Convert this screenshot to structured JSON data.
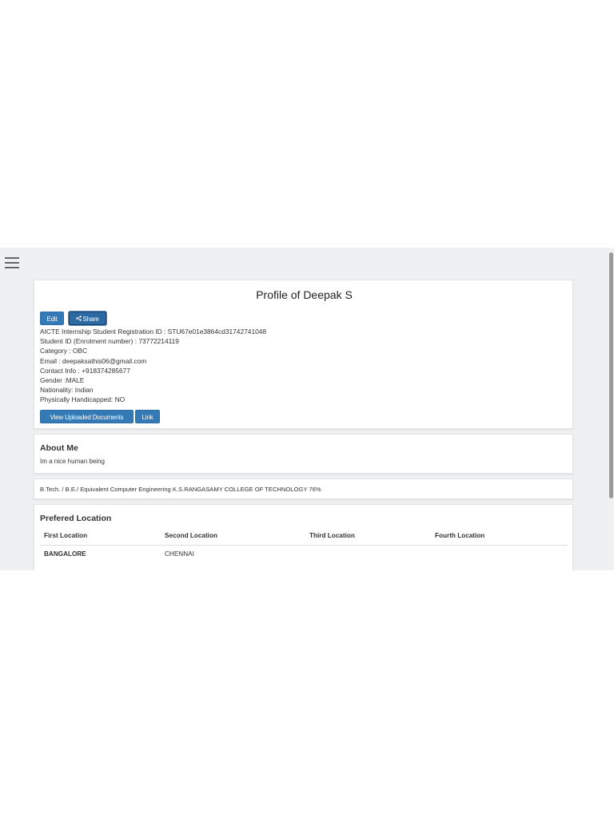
{
  "profile": {
    "title": "Profile of Deepak S",
    "edit_label": "Edit",
    "share_label": "Share",
    "info_lines": [
      "AICTE Internship Student Registration ID : STU67e01e3864cd31742741048",
      "Student ID (Enrolment number) : 73772214119",
      "Category : OBC",
      "Email : deepaksathis06@gmail.com",
      "Contact Info : +918374285677",
      "Gender :MALE",
      "Nationality: Indian",
      "Physically Handicapped: NO"
    ],
    "view_docs_label": "View Uploaded Documents",
    "link_label": "Link"
  },
  "about": {
    "title": "About Me",
    "text": "Im a nice human being"
  },
  "education": {
    "text": "B.Tech. / B.E./ Equivalent Computer Engineering K.S.RANGASAMY COLLEGE OF TECHNOLOGY 76%"
  },
  "locations": {
    "title": "Prefered Location",
    "headers": [
      "First Location",
      "Second Location",
      "Third Location",
      "Fourth Location"
    ],
    "values": [
      "BANGALORE",
      "CHENNAI",
      "",
      ""
    ]
  },
  "colors": {
    "primary_button": "#337ab7",
    "background": "#eef0f2"
  },
  "icons": {
    "menu": "hamburger-menu-icon",
    "share": "share-icon"
  }
}
